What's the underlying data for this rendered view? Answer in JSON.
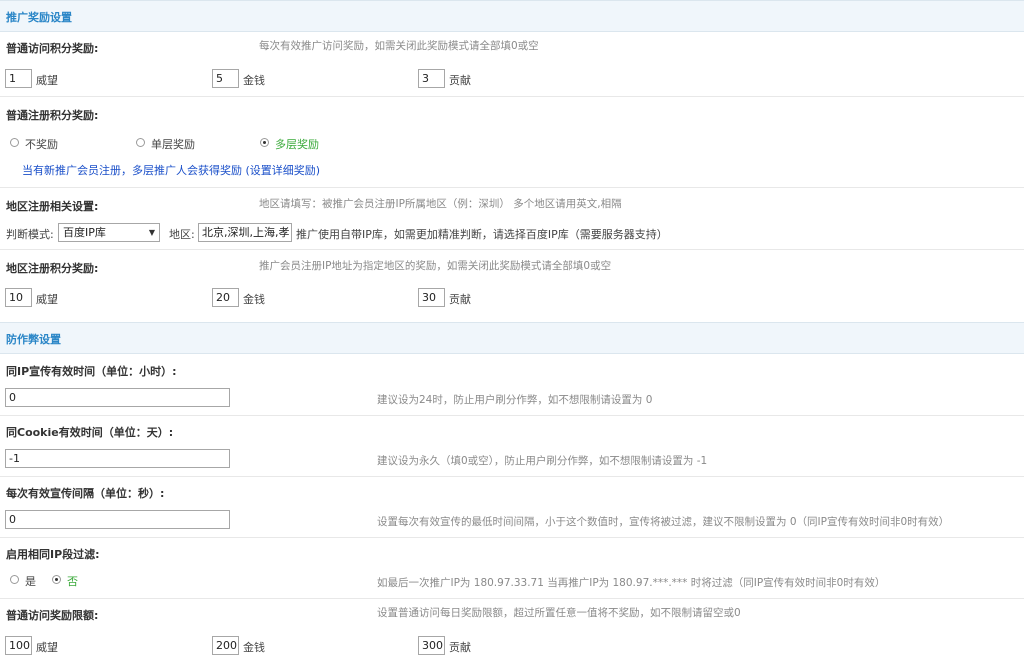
{
  "promo": {
    "section_title": "推广奖励设置",
    "visit_label": "普通访问积分奖励:",
    "visit_hint": "每次有效推广访问奖励，如需关闭此奖励模式请全部填0或空",
    "visit_values": {
      "weiwang": "1",
      "jinqian": "5",
      "gongxian": "3"
    },
    "unit_weiwang": "威望",
    "unit_jinqian": "金钱",
    "unit_gongxian": "贡献",
    "reg_label": "普通注册积分奖励:",
    "reg_options": [
      "不奖励",
      "单层奖励",
      "多层奖励"
    ],
    "reg_selected": "多层奖励",
    "reg_note": "当有新推广会员注册，多层推广人会获得奖励 (设置详细奖励)",
    "region_label": "地区注册相关设置:",
    "region_hint": "地区请填写：被推广会员注册IP所属地区（例：深圳） 多个地区请用英文,相隔",
    "judge_label": "判断模式:",
    "judge_value": "百度IP库",
    "region_field_label": "地区:",
    "region_value": "北京,深圳,上海,孝感",
    "region_note": "推广使用自带IP库，如需更加精准判断，请选择百度IP库（需要服务器支持）",
    "region_reward_label": "地区注册积分奖励:",
    "region_reward_hint": "推广会员注册IP地址为指定地区的奖励，如需关闭此奖励模式请全部填0或空",
    "region_values": {
      "weiwang": "10",
      "jinqian": "20",
      "gongxian": "30"
    }
  },
  "anti": {
    "section_title": "防作弊设置",
    "ip_time_label": "同IP宣传有效时间（单位：小时）:",
    "ip_time_value": "0",
    "ip_time_hint": "建议设为24时，防止用户刷分作弊，如不想限制请设置为 0",
    "cookie_label": "同Cookie有效时间（单位：天）:",
    "cookie_value": "-1",
    "cookie_hint": "建议设为永久（填0或空），防止用户刷分作弊，如不想限制请设置为 -1",
    "interval_label": "每次有效宣传间隔（单位：秒）:",
    "interval_value": "0",
    "interval_hint": "设置每次有效宣传的最低时间间隔，小于这个数值时，宣传将被过滤，建议不限制设置为 0（同IP宣传有效时间非0时有效）",
    "filter_label": "启用相同IP段过滤:",
    "filter_options": [
      "是",
      "否"
    ],
    "filter_selected": "否",
    "filter_hint": "如最后一次推广IP为 180.97.33.71 当再推广IP为 180.97.***.*** 时将过滤（同IP宣传有效时间非0时有效）",
    "limit_label": "普通访问奖励限额:",
    "limit_hint": "设置普通访问每日奖励限额，超过所置任意一值将不奖励，如不限制请留空或0",
    "limit_values": {
      "weiwang": "100",
      "jinqian": "200",
      "gongxian": "300"
    }
  }
}
